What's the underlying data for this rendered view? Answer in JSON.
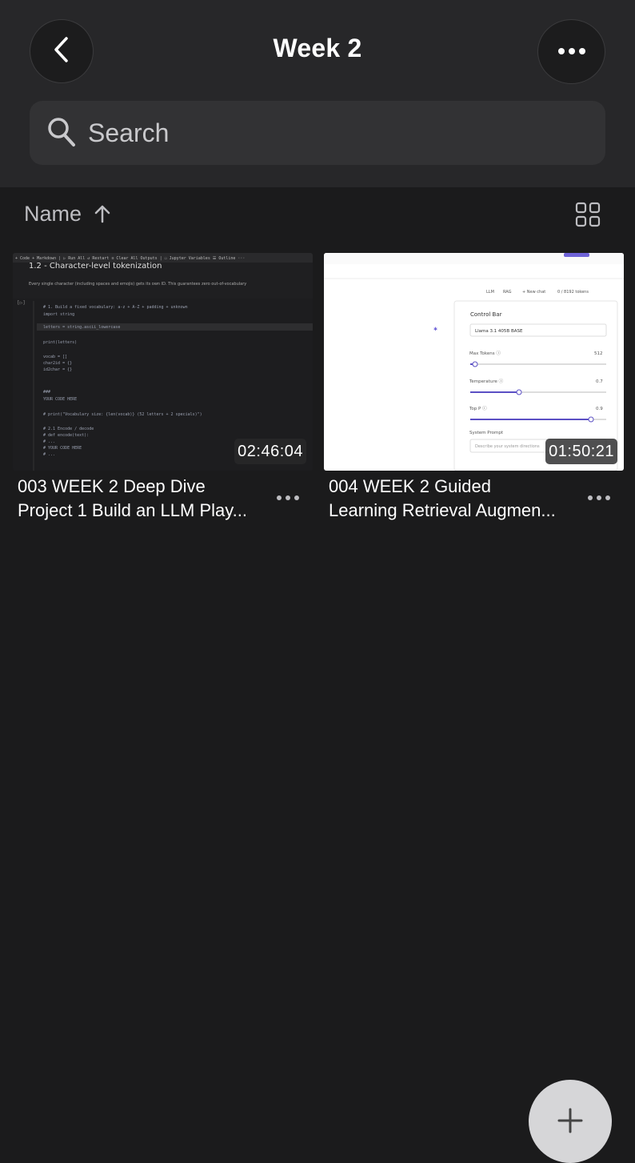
{
  "header": {
    "title": "Week 2",
    "back_icon": "chevron-left-icon",
    "more_icon": "ellipsis-icon"
  },
  "search": {
    "placeholder": "Search",
    "icon": "search-icon"
  },
  "sort": {
    "label": "Name",
    "direction_icon": "arrow-up-icon",
    "view_icon": "grid-view-icon"
  },
  "items": [
    {
      "title_line1": "003 WEEK 2 Deep Dive",
      "title_line2": "Project 1 Build an LLM Play...",
      "duration": "02:46:04",
      "thumb": {
        "toolbar": "+ Code  + Markdown  |  ▷ Run All  ↺ Restart  ≡ Clear All Outputs  |  ☐ Jupyter Variables  ☰ Outline  ···",
        "heading": "1.2 - Character-level tokenization",
        "desc": "Every single character (including spaces and emojis) gets its own ID. This guarantees zero out-of-vocabulary",
        "code": [
          "# 1. Build a fixed vocabulary: a-z + A-Z + padding + unknown",
          "import string",
          "letters = string.ascii_lowercase",
          "print(letters)",
          "vocab = []",
          "char2id = {}",
          "id2char = {}",
          "###",
          "YOUR CODE HERE",
          "# print(\"Vocabulary size: {len(vocab)} (52 letters + 2 specials)\")",
          "# 2.1 Encode / decode",
          "# def encode(text):",
          "#     ...",
          "#     YOUR CODE HERE",
          "#     ..."
        ]
      }
    },
    {
      "title_line1": "004 WEEK 2 Guided",
      "title_line2": "Learning Retrieval Augmen...",
      "duration": "01:50:21",
      "thumb": {
        "tabs": [
          "LLM",
          "RAG",
          "+ New chat",
          "0 / 8192 tokens"
        ],
        "panel_title": "Control Bar",
        "model": "Llama 3.1 405B BASE",
        "max_tokens_label": "Max Tokens ⓘ",
        "max_tokens_value": "512",
        "temperature_label": "Temperature ⓘ",
        "temperature_value": "0.7",
        "top_p_label": "Top P ⓘ",
        "top_p_value": "0.9",
        "system_prompt_label": "System Prompt",
        "system_prompt_text": "Describe your system directions"
      }
    }
  ],
  "fab": {
    "icon": "plus-icon"
  }
}
